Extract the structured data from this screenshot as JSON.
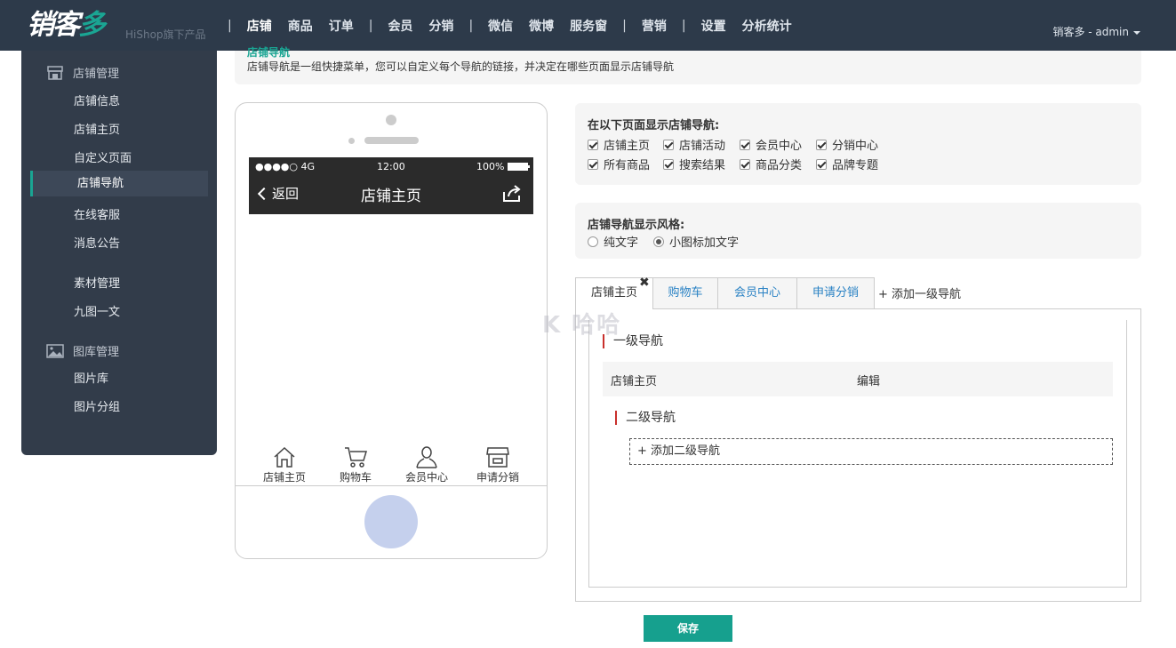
{
  "brand": {
    "logo_main": "销客",
    "logo_accent": "多",
    "sub": "HiShop旗下产品"
  },
  "topnav": {
    "items": [
      "店铺",
      "商品",
      "订单",
      "会员",
      "分销",
      "微信",
      "微博",
      "服务窗",
      "营销",
      "设置",
      "分析统计"
    ],
    "separator": "|",
    "user": "销客多 - admin"
  },
  "sidebar": {
    "group1": "店铺管理",
    "items1": [
      "店铺信息",
      "店铺主页",
      "自定义页面",
      "店铺导航",
      "在线客服",
      "消息公告",
      "素材管理",
      "九图一文"
    ],
    "group2": "图库管理",
    "items2": [
      "图片库",
      "图片分组"
    ]
  },
  "header": {
    "title": "店铺导航",
    "desc": "店铺导航是一组快捷菜单，您可以自定义每个导航的链接，并决定在哪些页面显示店铺导航"
  },
  "phone": {
    "signal": "●●●●○ 4G",
    "time": "12:00",
    "battery": "100%",
    "back": "返回",
    "title": "店铺主页",
    "tabs": [
      "店铺主页",
      "购物车",
      "会员中心",
      "申请分销"
    ]
  },
  "pages_panel": {
    "title": "在以下页面显示店铺导航:",
    "options": [
      "店铺主页",
      "店铺活动",
      "会员中心",
      "分销中心",
      "所有商品",
      "搜索结果",
      "商品分类",
      "品牌专题"
    ]
  },
  "style_panel": {
    "title": "店铺导航显示风格:",
    "options": [
      "纯文字",
      "小图标加文字"
    ],
    "selected": "小图标加文字"
  },
  "nav_tabs": {
    "tabs": [
      "店铺主页",
      "购物车",
      "会员中心",
      "申请分销"
    ],
    "close": "✖",
    "add": "+ 添加一级导航"
  },
  "editor": {
    "level1": "一级导航",
    "row_name": "店铺主页",
    "row_action": "编辑",
    "level2": "二级导航",
    "add_sub": "+ 添加二级导航"
  },
  "save_label": "保存",
  "watermark": "K 哈哈"
}
